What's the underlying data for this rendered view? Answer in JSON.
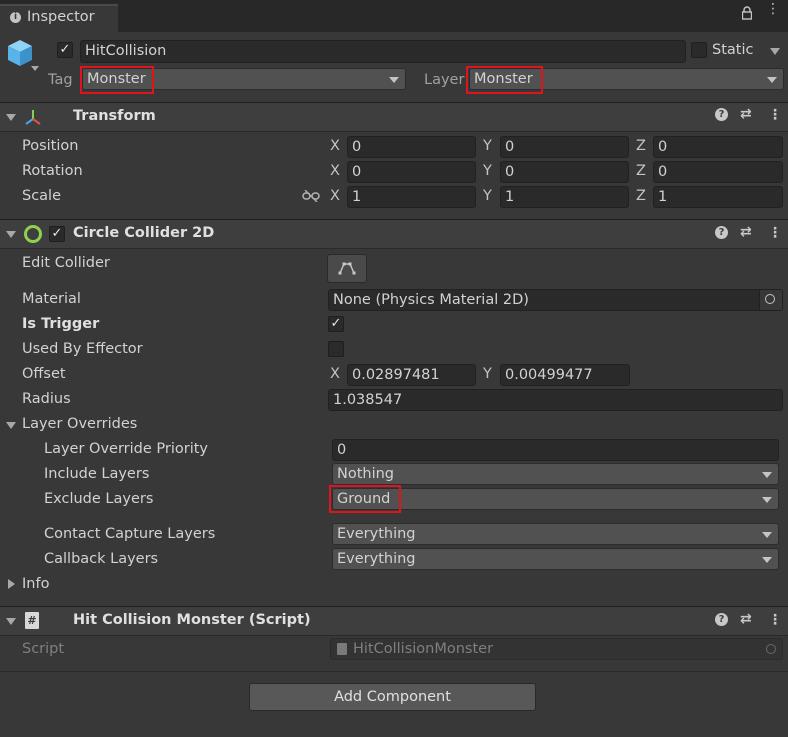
{
  "tab": {
    "title": "Inspector"
  },
  "object": {
    "name": "HitCollision",
    "static_label": "Static",
    "tag_label": "Tag",
    "tag_value": "Monster",
    "layer_label": "Layer",
    "layer_value": "Monster"
  },
  "transform": {
    "title": "Transform",
    "position": {
      "label": "Position",
      "x": "0",
      "y": "0",
      "z": "0"
    },
    "rotation": {
      "label": "Rotation",
      "x": "0",
      "y": "0",
      "z": "0"
    },
    "scale": {
      "label": "Scale",
      "x": "1",
      "y": "1",
      "z": "1"
    }
  },
  "axes": {
    "x": "X",
    "y": "Y",
    "z": "Z"
  },
  "collider": {
    "title": "Circle Collider 2D",
    "edit_collider": "Edit Collider",
    "material_label": "Material",
    "material_value": "None (Physics Material 2D)",
    "is_trigger": "Is Trigger",
    "used_by_effector": "Used By Effector",
    "offset_label": "Offset",
    "offset_x": "0.02897481",
    "offset_y": "0.00499477",
    "radius_label": "Radius",
    "radius_value": "1.038547",
    "layer_overrides": "Layer Overrides",
    "priority_label": "Layer Override Priority",
    "priority_value": "0",
    "include_label": "Include Layers",
    "include_value": "Nothing",
    "exclude_label": "Exclude Layers",
    "exclude_value": "Ground",
    "contact_label": "Contact Capture Layers",
    "contact_value": "Everything",
    "callback_label": "Callback Layers",
    "callback_value": "Everything",
    "info": "Info"
  },
  "script": {
    "title": "Hit Collision Monster (Script)",
    "label": "Script",
    "value": "HitCollisionMonster"
  },
  "add_component": "Add Component",
  "colors": {
    "background": "#383838",
    "field": "#2a2a2a",
    "highlight": "#e0141c",
    "collider_icon": "#8fd14f",
    "object_icon": "#57b3e8"
  }
}
